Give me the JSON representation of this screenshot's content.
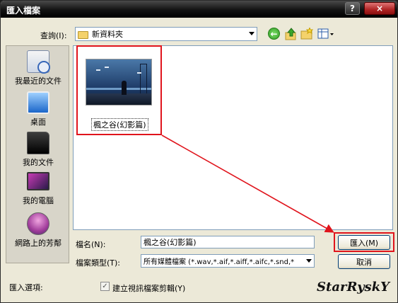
{
  "window": {
    "title": "匯入檔案",
    "help_label": "?",
    "close_label": "×"
  },
  "toolbar": {
    "look_in_label": "查詢(I):",
    "look_in_value": "新資料夾",
    "icons": [
      "back-icon",
      "up-folder-icon",
      "new-folder-icon",
      "view-menu-icon"
    ]
  },
  "places": [
    {
      "label": "我最近的文件",
      "icon": "recent-documents-icon"
    },
    {
      "label": "桌面",
      "icon": "desktop-icon"
    },
    {
      "label": "我的文件",
      "icon": "my-documents-icon"
    },
    {
      "label": "我的電腦",
      "icon": "my-computer-icon"
    },
    {
      "label": "網路上的芳鄰",
      "icon": "network-places-icon"
    }
  ],
  "file": {
    "name": "楓之谷(幻影篇)"
  },
  "form": {
    "filename_label": "檔名(N):",
    "filename_value": "楓之谷(幻影篇)",
    "filetype_label": "檔案類型(T):",
    "filetype_value": "所有媒體檔案 (*.wav,*.aif,*.aiff,*.aifc,*.snd,*"
  },
  "buttons": {
    "import": "匯入(M)",
    "cancel": "取消"
  },
  "options": {
    "label": "匯入選項:",
    "checkbox_label": "建立視訊檔案剪輯(Y)",
    "checked": true
  },
  "watermark": "StarRyskY",
  "colors": {
    "highlight": "#e0141c",
    "title_bar": "#141414"
  }
}
